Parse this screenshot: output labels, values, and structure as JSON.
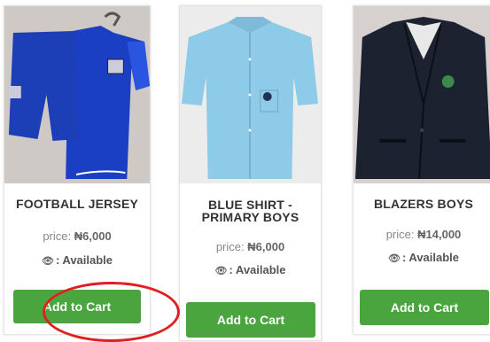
{
  "currency_symbol": "₦",
  "products": [
    {
      "name": "FOOTBALL JERSEY",
      "price_label": "price:",
      "price_value": "₦6,000",
      "availability": ": Available",
      "button_label": "Add to Cart",
      "image_icon": "football-jersey-image"
    },
    {
      "name_line1": "BLUE SHIRT -",
      "name_line2": "PRIMARY BOYS",
      "price_label": "price:",
      "price_value": "₦6,000",
      "availability": ": Available",
      "button_label": "Add to Cart",
      "image_icon": "blue-shirt-image"
    },
    {
      "name": "BLAZERS BOYS",
      "price_label": "price:",
      "price_value": "₦14,000",
      "availability": ": Available",
      "button_label": "Add to Cart",
      "image_icon": "blazer-image"
    }
  ],
  "colors": {
    "button": "#4aa53f",
    "highlight_ring": "#e02020"
  }
}
